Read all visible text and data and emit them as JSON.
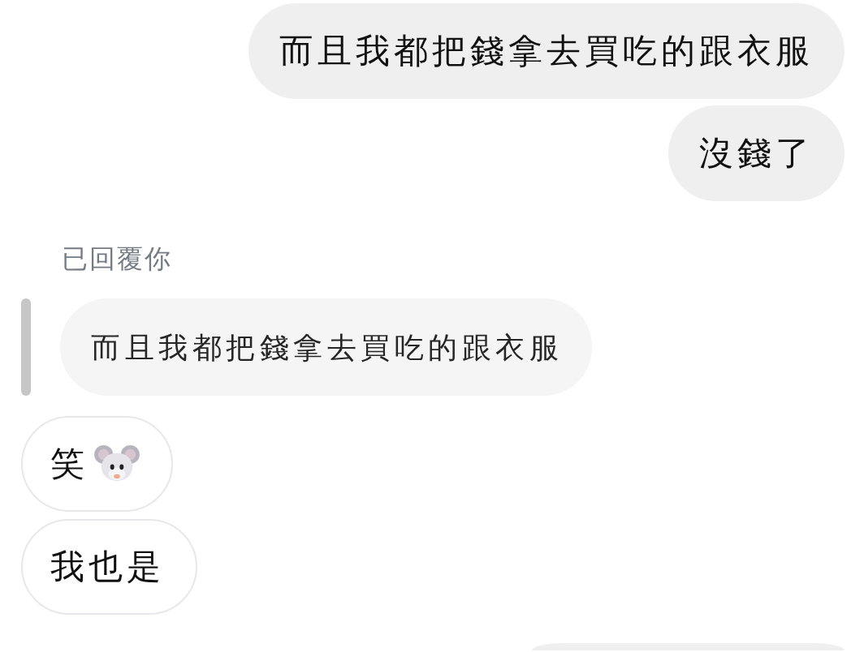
{
  "messages": [
    {
      "kind": "outgoing",
      "text": "而且我都把錢拿去買吃的跟衣服",
      "emoji": false
    },
    {
      "kind": "outgoing",
      "text": "沒錢了",
      "emoji": false
    },
    {
      "kind": "reply_note",
      "text": "已回覆你"
    },
    {
      "kind": "quote",
      "text": "而且我都把錢拿去買吃的跟衣服"
    },
    {
      "kind": "incoming",
      "text": "笑",
      "emoji": true
    },
    {
      "kind": "incoming",
      "text": "我也是",
      "emoji": false
    },
    {
      "kind": "outgoing_cut_off"
    }
  ]
}
